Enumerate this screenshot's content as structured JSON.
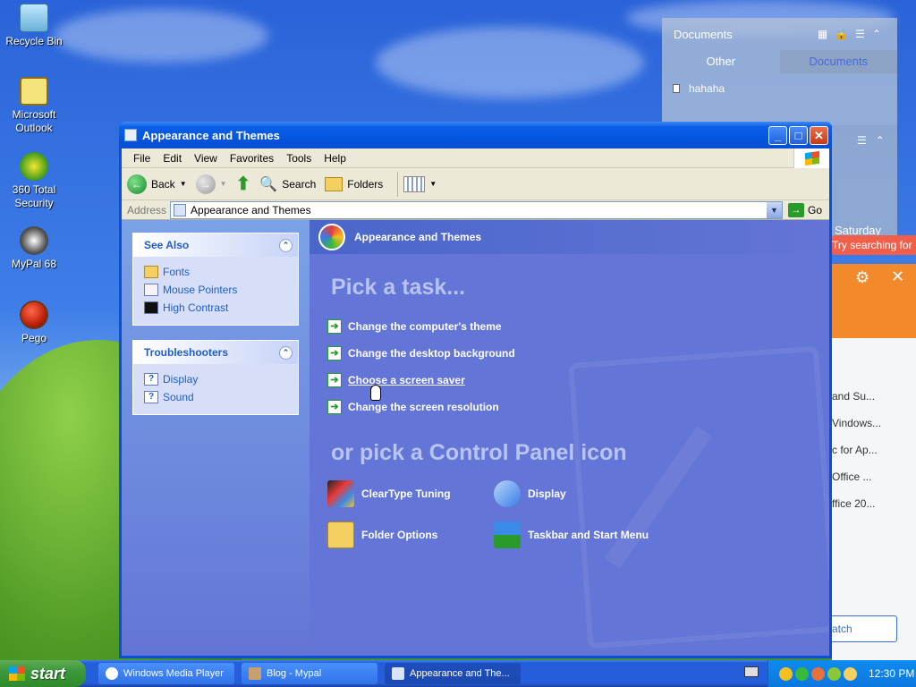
{
  "desktop": {
    "icons": [
      {
        "label": "Recycle Bin"
      },
      {
        "label": "Microsoft Outlook"
      },
      {
        "label": "360 Total Security"
      },
      {
        "label": "MyPal 68"
      },
      {
        "label": "Pego"
      }
    ]
  },
  "side_panel": {
    "title": "Documents",
    "tabs": [
      "Other",
      "Documents"
    ],
    "item": "hahaha",
    "day": "Saturday",
    "search_tip": "Try searching for",
    "list_items": [
      "and Su...",
      "Vindows...",
      "c for Ap...",
      "Office ...",
      "ffice 20..."
    ],
    "button_label": "atch"
  },
  "window": {
    "title": "Appearance and Themes",
    "menu": [
      "File",
      "Edit",
      "View",
      "Favorites",
      "Tools",
      "Help"
    ],
    "toolbar": {
      "back": "Back",
      "search": "Search",
      "folders": "Folders"
    },
    "address": {
      "label": "Address",
      "value": "Appearance and Themes",
      "go": "Go"
    },
    "see_also": {
      "title": "See Also",
      "items": [
        "Fonts",
        "Mouse Pointers",
        "High Contrast"
      ]
    },
    "troubleshooters": {
      "title": "Troubleshooters",
      "items": [
        "Display",
        "Sound"
      ]
    },
    "main": {
      "header": "Appearance and Themes",
      "pick_task": "Pick a task...",
      "tasks": [
        "Change the computer's theme",
        "Change the desktop background",
        "Choose a screen saver",
        "Change the screen resolution"
      ],
      "or_pick": "or pick a Control Panel icon",
      "icons": [
        "ClearType Tuning",
        "Display",
        "Folder Options",
        "Taskbar and Start Menu"
      ]
    }
  },
  "taskbar": {
    "start": "start",
    "buttons": [
      "Windows Media Player",
      "Blog - Mypal",
      "Appearance and The..."
    ],
    "clock": "12:30 PM"
  }
}
